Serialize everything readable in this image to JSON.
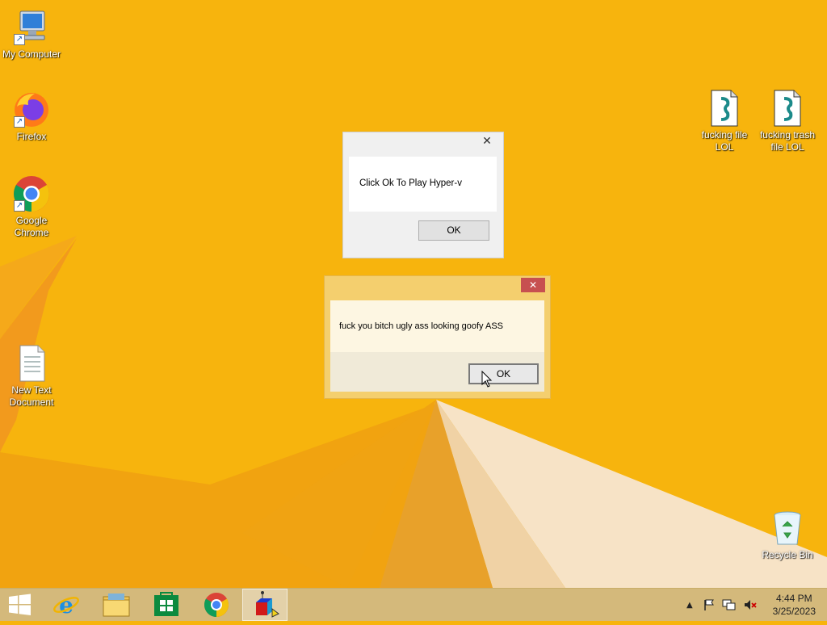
{
  "desktop": {
    "icons": [
      {
        "label": "My Computer",
        "icon": "computer-icon"
      },
      {
        "label": "Firefox",
        "icon": "firefox-icon"
      },
      {
        "label": "Google Chrome",
        "icon": "chrome-icon"
      },
      {
        "label": "New Text Document",
        "icon": "text-document-icon"
      },
      {
        "label": "fucking file LOL",
        "icon": "script-file-icon"
      },
      {
        "label": "fucking trash file LOL",
        "icon": "script-file-icon"
      },
      {
        "label": "Recycle Bin",
        "icon": "recycle-bin-icon"
      }
    ]
  },
  "dialog1": {
    "message": "Click Ok To Play Hyper-v",
    "ok_label": "OK",
    "close_glyph": "✕"
  },
  "dialog2": {
    "message": "fuck you bitch ugly ass looking goofy ASS",
    "ok_label": "OK",
    "close_glyph": "✕"
  },
  "taskbar": {
    "items": [
      {
        "name": "start-button",
        "icon": "windows-logo-icon"
      },
      {
        "name": "internet-explorer",
        "icon": "internet-explorer-icon"
      },
      {
        "name": "file-explorer",
        "icon": "folder-icon"
      },
      {
        "name": "store",
        "icon": "store-icon"
      },
      {
        "name": "chrome",
        "icon": "chrome-icon"
      },
      {
        "name": "running-app",
        "icon": "app-cube-icon"
      }
    ],
    "clock": {
      "time": "4:44 PM",
      "date": "3/25/2023"
    }
  },
  "colors": {
    "wallpaper": "#f7b40d",
    "dialog2_close": "#c75050"
  }
}
